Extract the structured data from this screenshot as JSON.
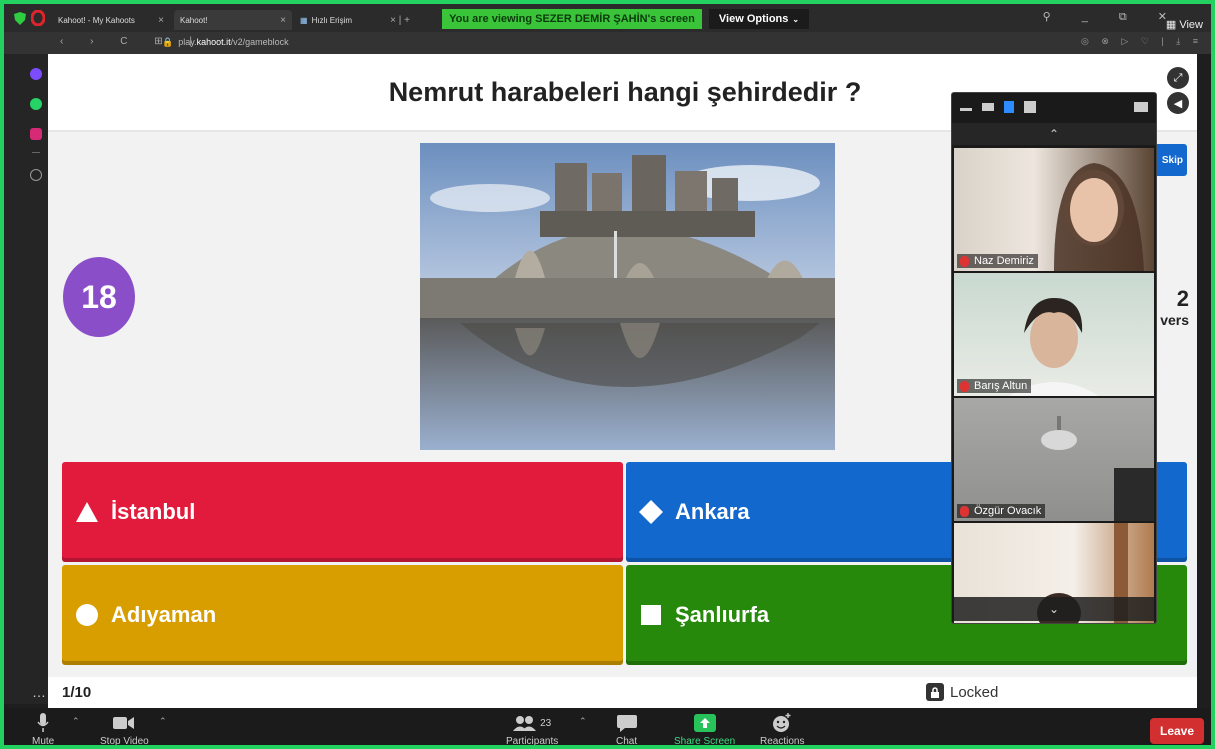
{
  "browser": {
    "tabs": [
      {
        "label": "Kahoot! - My Kahoots"
      },
      {
        "label": "Kahoot!"
      },
      {
        "label": "Hızlı Erişim"
      }
    ],
    "url_prefix": "play.",
    "url_domain": "kahoot.it",
    "url_path": "/v2/gameblock"
  },
  "zoom_banner": {
    "viewing_text": "You are viewing SEZER DEMİR ŞAHİN's screen",
    "view_options": "View Options",
    "view_label": "View"
  },
  "kahoot": {
    "question": "Nemrut harabeleri hangi şehirdedir ?",
    "timer": "18",
    "skip_label": "Skip",
    "answers_count": "2",
    "answers_label": "vers",
    "answers": [
      {
        "label": "İstanbul",
        "shape": "triangle",
        "color": "#e21b3c"
      },
      {
        "label": "Ankara",
        "shape": "diamond",
        "color": "#1368ce"
      },
      {
        "label": "Adıyaman",
        "shape": "circle",
        "color": "#d89e00"
      },
      {
        "label": "Şanlıurfa",
        "shape": "square",
        "color": "#26890c"
      }
    ],
    "question_index": "1/10",
    "locked_label": "Locked"
  },
  "participants_panel": {
    "tiles": [
      {
        "name": "Naz Demiriz"
      },
      {
        "name": "Barış Altun"
      },
      {
        "name": "Özgür Ovacık"
      },
      {
        "name": ""
      }
    ]
  },
  "toolbar": {
    "mute": "Mute",
    "stop_video": "Stop Video",
    "participants": "Participants",
    "participants_count": "23",
    "chat": "Chat",
    "share_screen": "Share Screen",
    "reactions": "Reactions",
    "leave": "Leave"
  },
  "colors": {
    "zoom_border": "#23d160",
    "kahoot_purple": "#8a4ec8",
    "leave_red": "#d23030"
  }
}
